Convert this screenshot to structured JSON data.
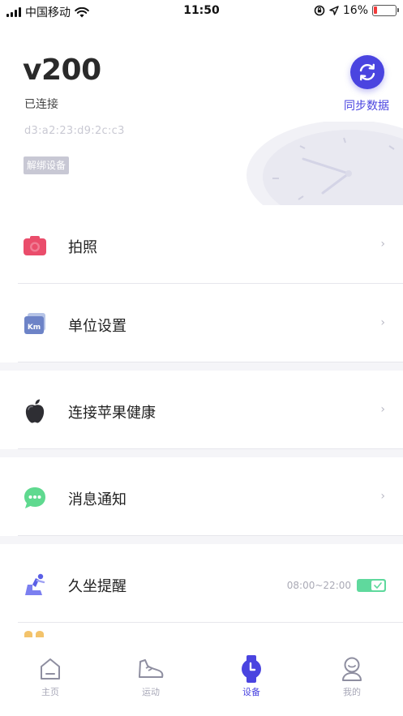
{
  "status_bar": {
    "carrier": "中国移动",
    "time": "11:50",
    "battery": "16%",
    "battery_level": 0.16,
    "icons": [
      "signal-bars-icon",
      "wifi-icon",
      "rotation-lock-icon",
      "location-arrow-icon",
      "battery-icon"
    ]
  },
  "device": {
    "name": "v200",
    "status": "已连接",
    "mac": "d3:a2:23:d9:2c:c3",
    "unbind_label": "解绑设备"
  },
  "sync": {
    "label": "同步数据",
    "icon": "sync-icon",
    "color": "#4a44e0"
  },
  "menu": {
    "photo": {
      "label": "拍照",
      "icon": "camera-icon",
      "chevron": "›"
    },
    "units": {
      "label": "单位设置",
      "icon": "km-unit-icon",
      "chevron": "›"
    },
    "apple_health": {
      "label": "连接苹果健康",
      "icon": "apple-icon",
      "chevron": "›"
    },
    "notifications": {
      "label": "消息通知",
      "icon": "chat-bubble-icon",
      "chevron": "›"
    },
    "sedentary": {
      "label": "久坐提醒",
      "icon": "sitting-person-icon",
      "time_range": "08:00~22:00",
      "toggle_on": true
    }
  },
  "tabs": [
    {
      "label": "主页",
      "icon": "home-icon",
      "active": false
    },
    {
      "label": "运动",
      "icon": "shoe-icon",
      "active": false
    },
    {
      "label": "设备",
      "icon": "watch-icon",
      "active": true
    },
    {
      "label": "我的",
      "icon": "profile-icon",
      "active": false
    }
  ],
  "colors": {
    "accent": "#4a44e0",
    "toggle_on": "#5fd99d",
    "camera": "#ea4d6b",
    "chat": "#5fd98f"
  }
}
